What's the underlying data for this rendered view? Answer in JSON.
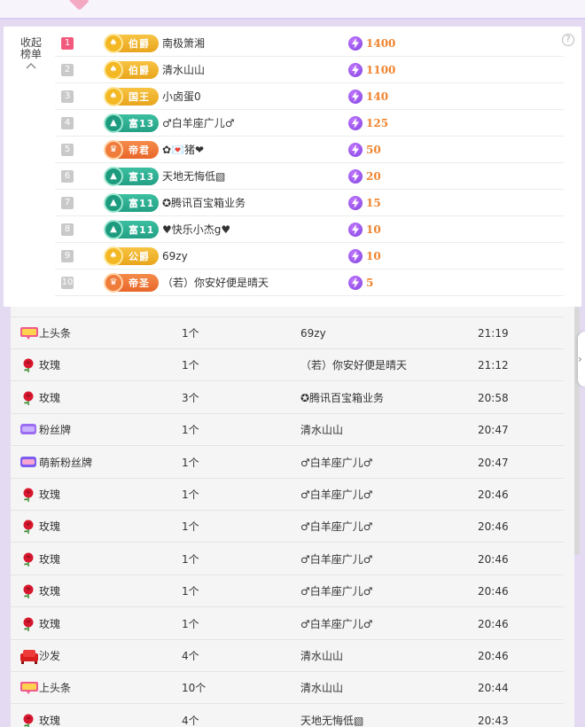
{
  "board": {
    "collapse_label": "收起榜单",
    "help_label": "?",
    "ranks": [
      {
        "rank": "1",
        "badge": "伯爵",
        "badge_style": "gold",
        "badge_emblem": "♠",
        "name": "南极箫湘",
        "score": "1400"
      },
      {
        "rank": "2",
        "badge": "伯爵",
        "badge_style": "gold",
        "badge_emblem": "♠",
        "name": "清水山山",
        "score": "1100"
      },
      {
        "rank": "3",
        "badge": "国王",
        "badge_style": "gold",
        "badge_emblem": "♠",
        "name": "小卤蛋0",
        "score": "140"
      },
      {
        "rank": "4",
        "badge": "富13",
        "badge_style": "green",
        "badge_emblem": "▲",
        "name": "♂白羊座广儿♂",
        "score": "125"
      },
      {
        "rank": "5",
        "badge": "帝君",
        "badge_style": "orange",
        "badge_emblem": "♛",
        "name": "✿💌猪❤",
        "score": "50"
      },
      {
        "rank": "6",
        "badge": "富13",
        "badge_style": "green",
        "badge_emblem": "▲",
        "name": "天地无悔低▧",
        "score": "20"
      },
      {
        "rank": "7",
        "badge": "富11",
        "badge_style": "green",
        "badge_emblem": "▲",
        "name": "✪腾讯百宝箱业务",
        "score": "15"
      },
      {
        "rank": "8",
        "badge": "富11",
        "badge_style": "green",
        "badge_emblem": "▲",
        "name": "♥快乐小杰g♥",
        "score": "10"
      },
      {
        "rank": "9",
        "badge": "公爵",
        "badge_style": "gold",
        "badge_emblem": "♠",
        "name": "69zy",
        "score": "10"
      },
      {
        "rank": "10",
        "badge": "帝圣",
        "badge_style": "orange",
        "badge_emblem": "♛",
        "name": "（若）你安好便是晴天",
        "score": "5"
      }
    ]
  },
  "records": [
    {
      "gift": "上头条",
      "icon": "headline-icon",
      "qty": "1个",
      "user": "69zy",
      "time": "21:19"
    },
    {
      "gift": "玫瑰",
      "icon": "rose-icon",
      "qty": "1个",
      "user": "（若）你安好便是晴天",
      "time": "21:12"
    },
    {
      "gift": "玫瑰",
      "icon": "rose-icon",
      "qty": "3个",
      "user": "✪腾讯百宝箱业务",
      "time": "20:58"
    },
    {
      "gift": "粉丝牌",
      "icon": "fan-badge-icon",
      "qty": "1个",
      "user": "清水山山",
      "time": "20:47"
    },
    {
      "gift": "萌新粉丝牌",
      "icon": "newbie-fan-badge-icon",
      "qty": "1个",
      "user": "♂白羊座广儿♂",
      "time": "20:47"
    },
    {
      "gift": "玫瑰",
      "icon": "rose-icon",
      "qty": "1个",
      "user": "♂白羊座广儿♂",
      "time": "20:46"
    },
    {
      "gift": "玫瑰",
      "icon": "rose-icon",
      "qty": "1个",
      "user": "♂白羊座广儿♂",
      "time": "20:46"
    },
    {
      "gift": "玫瑰",
      "icon": "rose-icon",
      "qty": "1个",
      "user": "♂白羊座广儿♂",
      "time": "20:46"
    },
    {
      "gift": "玫瑰",
      "icon": "rose-icon",
      "qty": "1个",
      "user": "♂白羊座广儿♂",
      "time": "20:46"
    },
    {
      "gift": "玫瑰",
      "icon": "rose-icon",
      "qty": "1个",
      "user": "♂白羊座广儿♂",
      "time": "20:46"
    },
    {
      "gift": "沙发",
      "icon": "sofa-icon",
      "qty": "4个",
      "user": "清水山山",
      "time": "20:46"
    },
    {
      "gift": "上头条",
      "icon": "headline-icon",
      "qty": "10个",
      "user": "清水山山",
      "time": "20:44"
    },
    {
      "gift": "玫瑰",
      "icon": "rose-icon",
      "qty": "4个",
      "user": "天地无悔低▧",
      "time": "20:43"
    }
  ],
  "side_tab": {
    "arrow": "›"
  },
  "colors": {
    "score": "#f0832d",
    "bolt": "#7c3fe0",
    "rank1": "#f25a7d",
    "background": "#e4dbf3"
  }
}
